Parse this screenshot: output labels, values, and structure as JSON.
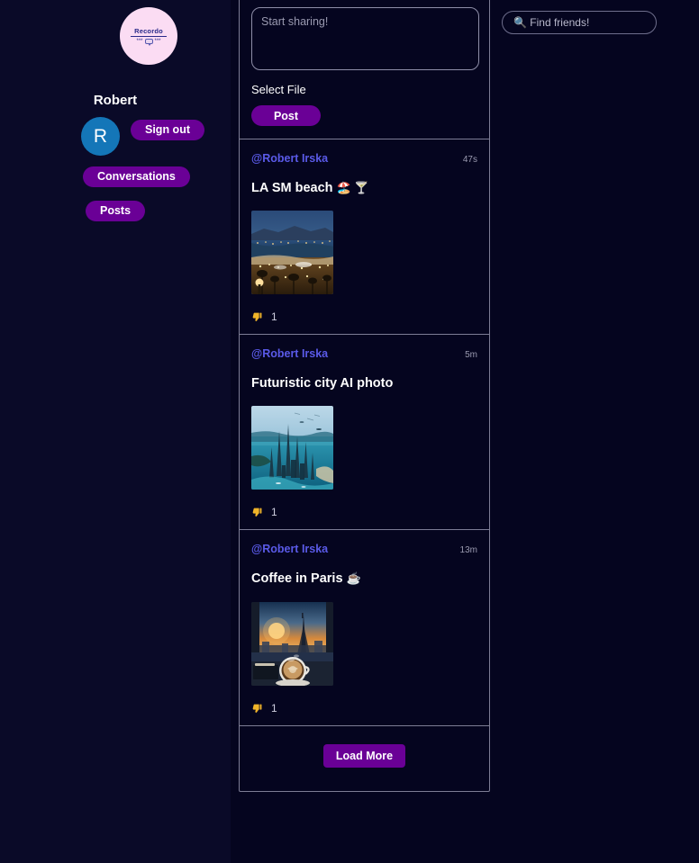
{
  "app": {
    "logo_text": "Recordo",
    "logo_deco_left": "***",
    "logo_deco_right": "***",
    "background_color": "#05051f",
    "accent_color": "#6a0096",
    "link_color": "#5a5ae8"
  },
  "sidebar": {
    "profile_name": "Robert",
    "avatar_initial": "R",
    "avatar_color": "#1476b8",
    "buttons": [
      {
        "label": "Sign out",
        "name": "sign-out-button"
      },
      {
        "label": "Conversations",
        "name": "conversations-button"
      },
      {
        "label": "Posts",
        "name": "posts-button"
      }
    ]
  },
  "composer": {
    "placeholder": "Start sharing!",
    "value": "",
    "select_file_label": "Select File",
    "post_label": "Post"
  },
  "feed": {
    "posts": [
      {
        "author": "@Robert Irska",
        "time": "47s",
        "title": "LA SM beach",
        "title_emoji": "🏖️ 🍸",
        "media": "la-beach-sunset-photo",
        "reaction_icon": "thumbs-down",
        "reaction_count": "1"
      },
      {
        "author": "@Robert Irska",
        "time": "5m",
        "title": "Futuristic city AI photo",
        "title_emoji": "",
        "media": "futuristic-city-photo",
        "reaction_icon": "thumbs-down",
        "reaction_count": "1"
      },
      {
        "author": "@Robert Irska",
        "time": "13m",
        "title": "Coffee in Paris",
        "title_emoji": "☕",
        "media": "paris-coffee-eiffel-photo",
        "reaction_icon": "thumbs-down",
        "reaction_count": "1"
      }
    ],
    "load_more_label": "Load More"
  },
  "right_panel": {
    "search_placeholder": "🔍 Find friends!",
    "search_value": ""
  }
}
